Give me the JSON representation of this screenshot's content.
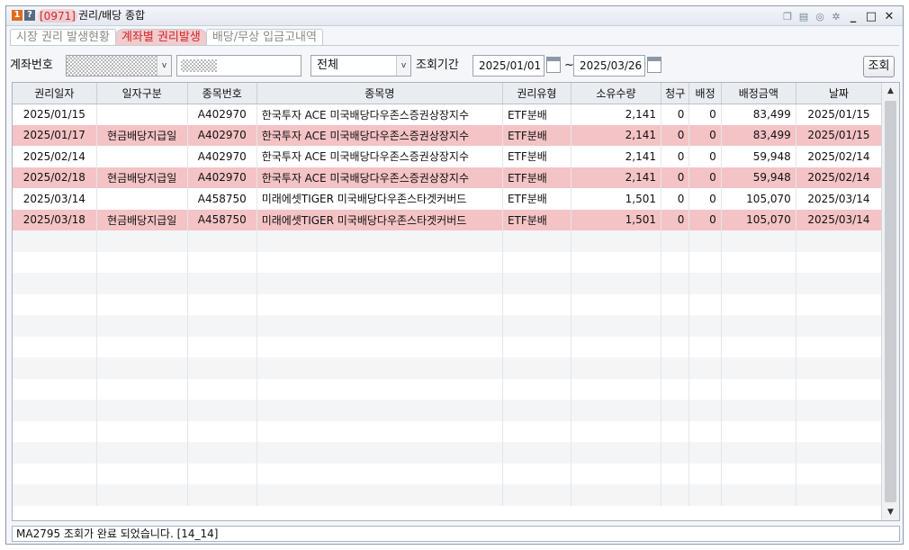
{
  "window": {
    "icon_one": "1",
    "icon_help": "?",
    "screen_code": "[0971]",
    "title": "권리/배당 종합",
    "tools": [
      "❐",
      "▤",
      "◎",
      "✲"
    ],
    "minimize": "_",
    "maximize": "□",
    "close": "✕"
  },
  "tabs": [
    {
      "label": "시장 권리 발생현황"
    },
    {
      "label": "계좌별 권리발생"
    },
    {
      "label": "배당/무상 입금고내역"
    }
  ],
  "filters": {
    "account_label": "계좌번호",
    "account_dropdown_arrow": "v",
    "type_value": "전체",
    "type_dropdown_arrow": "v",
    "period_label": "조회기간",
    "date_from": "2025/01/01",
    "date_separator": "~",
    "date_to": "2025/03/26",
    "search_button": "조회"
  },
  "table": {
    "columns": [
      "권리일자",
      "일자구분",
      "종목번호",
      "종목명",
      "권리유형",
      "소유수량",
      "청구",
      "배정",
      "배정금액",
      "날짜"
    ],
    "rows": [
      {
        "date": "2025/01/15",
        "kind": "",
        "code": "A402970",
        "name": "한국투자 ACE 미국배당다우존스증권상장지수",
        "type": "ETF분배",
        "qty": "2,141",
        "claim": "0",
        "alloc": "0",
        "amount": "83,499",
        "day": "2025/01/15",
        "highlight": false
      },
      {
        "date": "2025/01/17",
        "kind": "현금배당지급일",
        "code": "A402970",
        "name": "한국투자 ACE 미국배당다우존스증권상장지수",
        "type": "ETF분배",
        "qty": "2,141",
        "claim": "0",
        "alloc": "0",
        "amount": "83,499",
        "day": "2025/01/15",
        "highlight": true
      },
      {
        "date": "2025/02/14",
        "kind": "",
        "code": "A402970",
        "name": "한국투자 ACE 미국배당다우존스증권상장지수",
        "type": "ETF분배",
        "qty": "2,141",
        "claim": "0",
        "alloc": "0",
        "amount": "59,948",
        "day": "2025/02/14",
        "highlight": false
      },
      {
        "date": "2025/02/18",
        "kind": "현금배당지급일",
        "code": "A402970",
        "name": "한국투자 ACE 미국배당다우존스증권상장지수",
        "type": "ETF분배",
        "qty": "2,141",
        "claim": "0",
        "alloc": "0",
        "amount": "59,948",
        "day": "2025/02/14",
        "highlight": true
      },
      {
        "date": "2025/03/14",
        "kind": "",
        "code": "A458750",
        "name": "미래에셋TIGER 미국배당다우존스타겟커버드",
        "type": "ETF분배",
        "qty": "1,501",
        "claim": "0",
        "alloc": "0",
        "amount": "105,070",
        "day": "2025/03/14",
        "highlight": false
      },
      {
        "date": "2025/03/18",
        "kind": "현금배당지급일",
        "code": "A458750",
        "name": "미래에셋TIGER 미국배당다우존스타겟커버드",
        "type": "ETF분배",
        "qty": "1,501",
        "claim": "0",
        "alloc": "0",
        "amount": "105,070",
        "day": "2025/03/14",
        "highlight": true
      }
    ],
    "empty_rows": 13
  },
  "scrollbar": {
    "up": "▲",
    "down": "▼"
  },
  "status": {
    "message": "MA2795 조회가 완료 되었습니다. [14_14]"
  },
  "colors": {
    "highlight_row": "#f4c3c5",
    "accent_red": "#d0262a"
  }
}
